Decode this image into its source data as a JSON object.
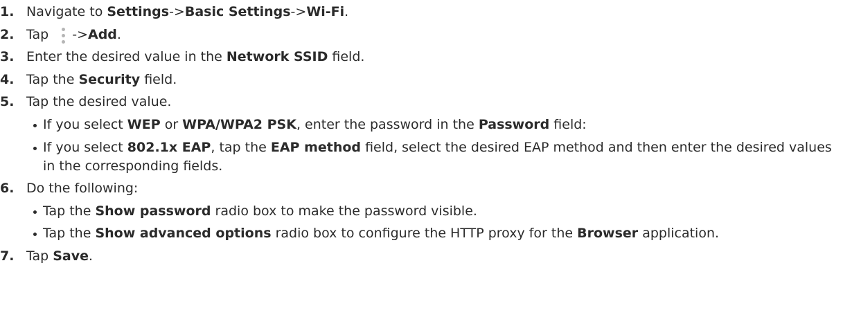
{
  "steps": [
    {
      "num": "1.",
      "parts": [
        "Navigate to ",
        "Settings",
        "->",
        "Basic Settings",
        "->",
        "Wi-Fi",
        "."
      ]
    },
    {
      "num": "2.",
      "parts": [
        "Tap ",
        "->",
        "Add",
        "."
      ]
    },
    {
      "num": "3.",
      "parts": [
        "Enter the desired value in the ",
        "Network SSID",
        " field."
      ]
    },
    {
      "num": "4.",
      "parts": [
        "Tap the ",
        "Security",
        " field."
      ]
    },
    {
      "num": "5.",
      "parts": [
        "Tap the desired value."
      ]
    },
    {
      "num": "6.",
      "parts": [
        "Do the following:"
      ]
    },
    {
      "num": "7.",
      "parts": [
        "Tap ",
        "Save",
        "."
      ]
    }
  ],
  "step5_bullets": [
    {
      "parts": [
        "If you select ",
        "WEP",
        " or ",
        "WPA/WPA2 PSK",
        ", enter the password in the ",
        "Password",
        " field:"
      ]
    },
    {
      "parts": [
        "If you select ",
        "802.1x EAP",
        ", tap the ",
        "EAP method",
        " field, select the desired EAP method and then enter the desired values in the corresponding fields."
      ]
    }
  ],
  "step6_bullets": [
    {
      "parts": [
        "Tap the ",
        "Show password",
        " radio box to make the password visible."
      ]
    },
    {
      "parts": [
        "Tap the ",
        "Show advanced options",
        " radio box to configure the HTTP proxy for the ",
        "Browser",
        " application."
      ]
    }
  ],
  "icons": {
    "more": "more-vert-icon"
  }
}
